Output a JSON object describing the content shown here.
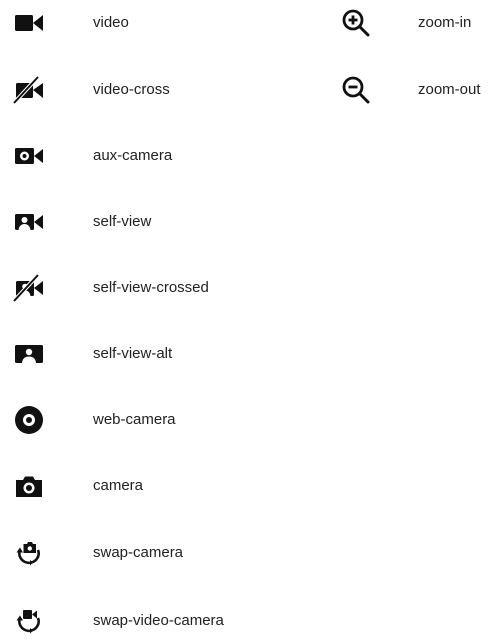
{
  "left_column": {
    "items": [
      {
        "icon": "video-icon",
        "label": "video"
      },
      {
        "icon": "video-cross-icon",
        "label": "video-cross"
      },
      {
        "icon": "aux-camera-icon",
        "label": "aux-camera"
      },
      {
        "icon": "self-view-icon",
        "label": "self-view"
      },
      {
        "icon": "self-view-crossed-icon",
        "label": "self-view-crossed"
      },
      {
        "icon": "self-view-alt-icon",
        "label": "self-view-alt"
      },
      {
        "icon": "web-camera-icon",
        "label": "web-camera"
      },
      {
        "icon": "camera-icon",
        "label": "camera"
      },
      {
        "icon": "swap-camera-icon",
        "label": "swap-camera"
      },
      {
        "icon": "swap-video-camera-icon",
        "label": "swap-video-camera"
      }
    ]
  },
  "right_column": {
    "items": [
      {
        "icon": "zoom-in-icon",
        "label": "zoom-in"
      },
      {
        "icon": "zoom-out-icon",
        "label": "zoom-out"
      }
    ]
  },
  "colors": {
    "icon": "#111111",
    "text": "#222222",
    "background": "#ffffff"
  }
}
